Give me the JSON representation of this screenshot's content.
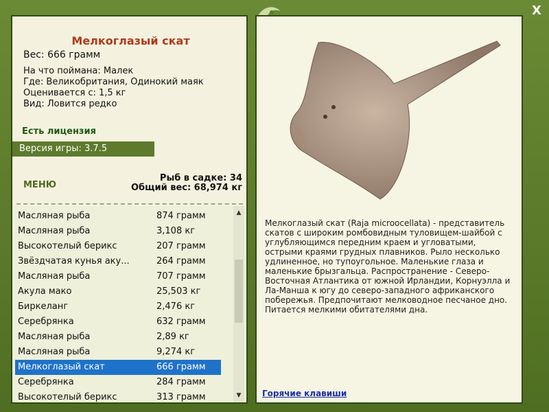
{
  "window": {
    "close_label": "X"
  },
  "fish": {
    "name": "Мелкоглазый скат",
    "weight": "Вес: 666 грамм",
    "caught_on": "На что поймана: Малек",
    "location": "Где: Великобритания, Одинокий маяк",
    "value": "Оценивается с: 1,5 кг",
    "rarity": "Вид: Ловится редко"
  },
  "license": "Есть лицензия",
  "version": "Версия игры: 3.7.5",
  "menu_label": "МЕНЮ",
  "tank": {
    "count": "Рыб в садке: 34",
    "total": "Общий вес: 68,974 кг"
  },
  "catch_list": [
    {
      "name": "Масляная рыба",
      "weight": "874 грамм"
    },
    {
      "name": "Масляная рыба",
      "weight": "3,108 кг"
    },
    {
      "name": "Высокотелый берикс",
      "weight": "207 грамм"
    },
    {
      "name": "Звёздчатая кунья аку...",
      "weight": "264 грамм"
    },
    {
      "name": "Масляная рыба",
      "weight": "707 грамм"
    },
    {
      "name": "Акула мако",
      "weight": "25,503 кг"
    },
    {
      "name": "Биркеланг",
      "weight": "2,476 кг"
    },
    {
      "name": "Серебрянка",
      "weight": "632 грамм"
    },
    {
      "name": "Масляная рыба",
      "weight": "2,89 кг"
    },
    {
      "name": "Масляная рыба",
      "weight": "9,274 кг"
    },
    {
      "name": "Мелкоглазый скат",
      "weight": "666 грамм"
    },
    {
      "name": "Серебрянка",
      "weight": "284 грамм"
    },
    {
      "name": "Высокотелый берикс",
      "weight": "313 грамм"
    }
  ],
  "selected_index": 10,
  "description": "Мелкоглазый скат (Raja microocellata) - представитель скатов с широким ромбовидным туловищем-шайбой с углубляющимся передним краем и угловатыми, острыми краями грудных плавников. Рыло несколько удлиненное, но тупоугольное. Маленькие глаза и маленькие брызгальца. Распространение - Северо-Восточная Атлантика от южной Ирландии, Корнуэлла и Ла-Манша к югу до северо-западного африканского побережья. Предпочитают мелководное песчаное дно. Питается мелкими обитателями дна.",
  "hotkeys_label": "Горячие клавиши",
  "icons": {
    "logo": "fish-logo-icon",
    "close": "close-icon",
    "scroll_up": "scroll-up-icon",
    "scroll_down": "scroll-down-icon"
  }
}
